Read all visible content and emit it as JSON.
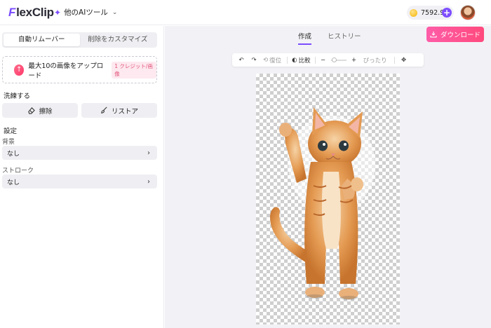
{
  "header": {
    "logo_text_accent": "F",
    "logo_text_rest": "lexClip",
    "ai_tools_label": "他のAIツール",
    "credits_value": "7592.9"
  },
  "left_panel": {
    "tabs": [
      {
        "label": "自動リムーバー",
        "active": true
      },
      {
        "label": "削除をカスタマイズ",
        "active": false
      }
    ],
    "upload": {
      "label": "最大10の画像をアップロード",
      "badge": "1 クレジット/画像"
    },
    "select_section_title": "洗練する",
    "erase_label": "擦除",
    "restore_label": "リストア",
    "settings_title": "設定",
    "background_label": "背景",
    "background_value": "なし",
    "stroke_label": "ストローク",
    "stroke_value": "なし"
  },
  "main": {
    "tabs": [
      {
        "label": "作成",
        "active": true
      },
      {
        "label": "ヒストリー",
        "active": false
      }
    ],
    "download_label": "ダウンロード",
    "toolbar": {
      "reset_label": "復位",
      "compare_label": "比較",
      "fit_label": "ぴったり",
      "zoom_value": 0.1
    }
  },
  "colors": {
    "accent": "#7d4dff",
    "download_start": "#ff5ca8",
    "download_end": "#ff4a7d",
    "badge_text": "#e2527a"
  },
  "icons": [
    "sparkle-icon",
    "chevron-down-icon",
    "coin-icon",
    "plus-icon",
    "upload-icon",
    "eraser-icon",
    "brush-icon",
    "chevron-right-icon",
    "download-icon",
    "undo-icon",
    "redo-icon",
    "reset-icon",
    "compare-icon",
    "zoom-out-icon",
    "zoom-in-icon",
    "move-icon"
  ]
}
